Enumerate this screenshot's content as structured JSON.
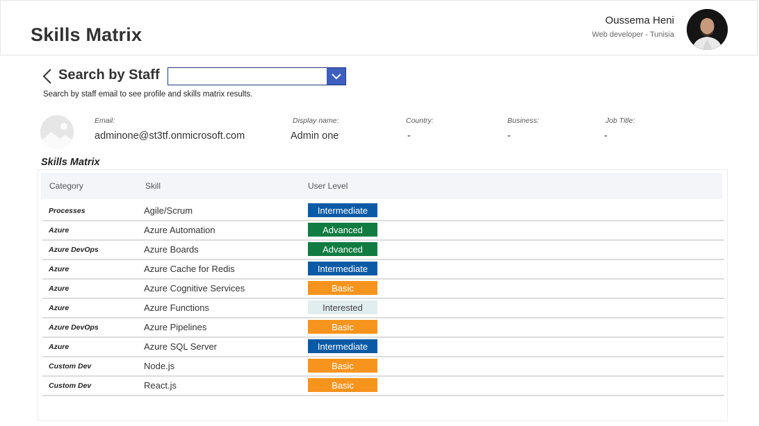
{
  "header": {
    "title": "Skills Matrix",
    "user_name": "Oussema Heni",
    "user_role": "Web developer - Tunisia"
  },
  "search": {
    "title": "Search by Staff",
    "value": "",
    "placeholder": "",
    "hint": "Search by staff email to see profile and skills matrix results."
  },
  "profile": {
    "email_label": "Email:",
    "email": "adminone@st3tf.onmicrosoft.com",
    "display_name_label": "Display name:",
    "display_name": "Admin one",
    "country_label": "Country:",
    "country": "-",
    "business_label": "Business:",
    "business": "-",
    "job_title_label": "Job Title:",
    "job_title": "-"
  },
  "matrix": {
    "title": "Skills Matrix",
    "columns": [
      "Category",
      "Skill",
      "User Level"
    ],
    "level_colors": {
      "Intermediate": {
        "bg": "#0b5aa6",
        "fg": "#ffffff"
      },
      "Advanced": {
        "bg": "#107c41",
        "fg": "#ffffff"
      },
      "Basic": {
        "bg": "#f7941d",
        "fg": "#ffffff"
      },
      "Interested": {
        "bg": "#e1eef0",
        "fg": "#444444"
      }
    },
    "rows": [
      {
        "category": "Processes",
        "skill": "Agile/Scrum",
        "level": "Intermediate"
      },
      {
        "category": "Azure",
        "skill": "Azure Automation",
        "level": "Advanced"
      },
      {
        "category": "Azure DevOps",
        "skill": "Azure Boards",
        "level": "Advanced"
      },
      {
        "category": "Azure",
        "skill": "Azure Cache for Redis",
        "level": "Intermediate"
      },
      {
        "category": "Azure",
        "skill": "Azure Cognitive Services",
        "level": "Basic"
      },
      {
        "category": "Azure",
        "skill": "Azure Functions",
        "level": "Interested"
      },
      {
        "category": "Azure DevOps",
        "skill": "Azure Pipelines",
        "level": "Basic"
      },
      {
        "category": "Azure",
        "skill": "Azure SQL Server",
        "level": "Intermediate"
      },
      {
        "category": "Custom Dev",
        "skill": "Node.js",
        "level": "Basic"
      },
      {
        "category": "Custom Dev",
        "skill": "React.js",
        "level": "Basic"
      }
    ]
  }
}
